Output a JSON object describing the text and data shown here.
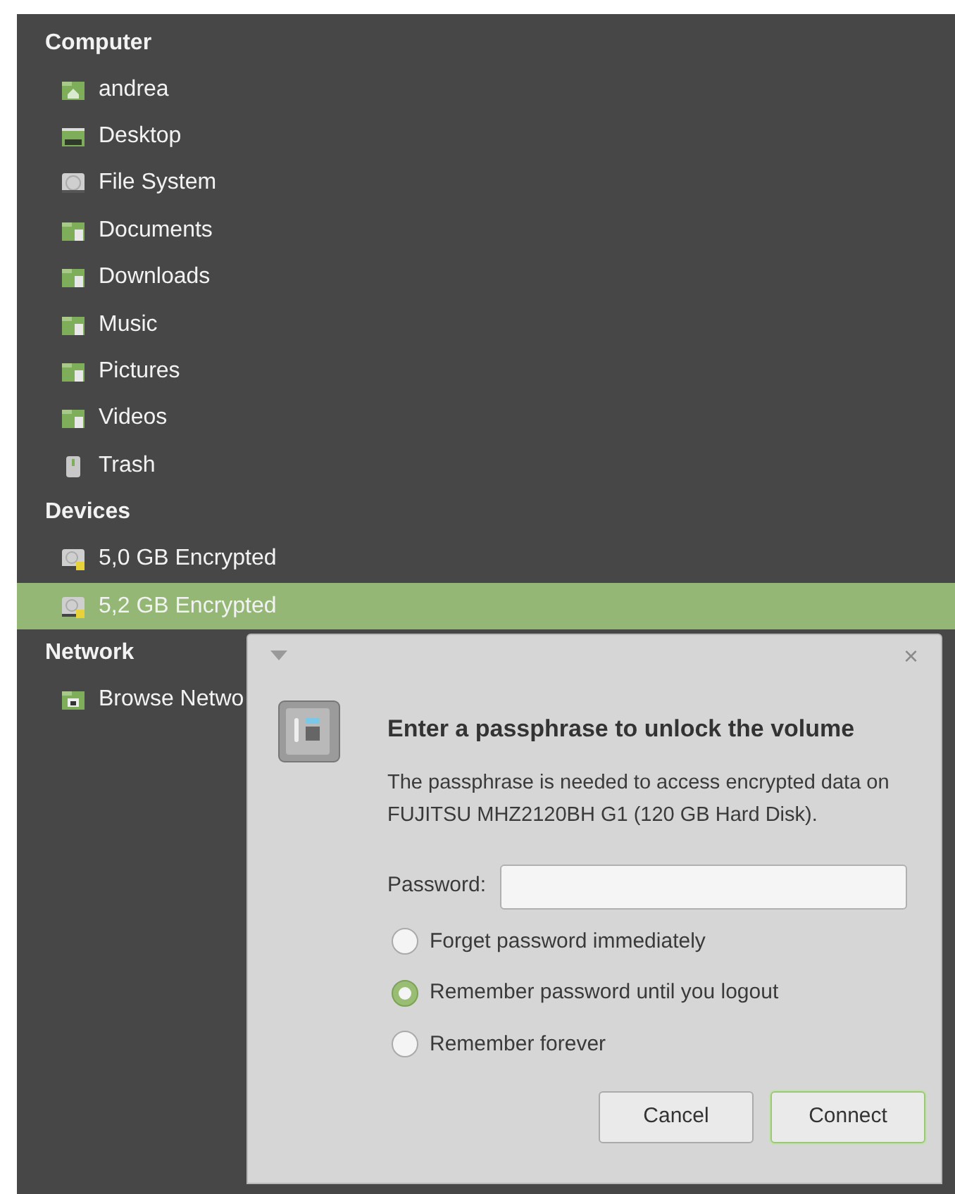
{
  "sidebar": {
    "sections": [
      {
        "heading": "Computer",
        "items": [
          {
            "label": "andrea",
            "kind": "home",
            "selected": false
          },
          {
            "label": "Desktop",
            "kind": "desktop",
            "selected": false
          },
          {
            "label": "File System",
            "kind": "drive",
            "selected": false
          },
          {
            "label": "Documents",
            "kind": "folder",
            "selected": false
          },
          {
            "label": "Downloads",
            "kind": "folder",
            "selected": false
          },
          {
            "label": "Music",
            "kind": "folder",
            "selected": false
          },
          {
            "label": "Pictures",
            "kind": "folder",
            "selected": false
          },
          {
            "label": "Videos",
            "kind": "folder",
            "selected": false
          },
          {
            "label": "Trash",
            "kind": "trash",
            "selected": false
          }
        ]
      },
      {
        "heading": "Devices",
        "items": [
          {
            "label": "5,0 GB Encrypted",
            "kind": "locked-drive",
            "selected": false
          },
          {
            "label": "5,2 GB Encrypted",
            "kind": "locked-drive",
            "selected": true
          }
        ]
      },
      {
        "heading": "Network",
        "items": [
          {
            "label": "Browse Netwo",
            "kind": "network",
            "selected": false
          }
        ]
      }
    ]
  },
  "dialog": {
    "close": "×",
    "heading": "Enter a passphrase to unlock the volume",
    "message": "The passphrase is needed to access encrypted data on FUJITSU MHZ2120BH G1 (120 GB Hard Disk).",
    "password": {
      "label": "Password:"
    },
    "options": [
      {
        "label": "Forget password immediately",
        "selected": false
      },
      {
        "label": "Remember password until you logout",
        "selected": true
      },
      {
        "label": "Remember forever",
        "selected": false
      }
    ],
    "buttons": [
      {
        "label": "Cancel",
        "default": false
      },
      {
        "label": "Connect",
        "default": true
      }
    ]
  }
}
